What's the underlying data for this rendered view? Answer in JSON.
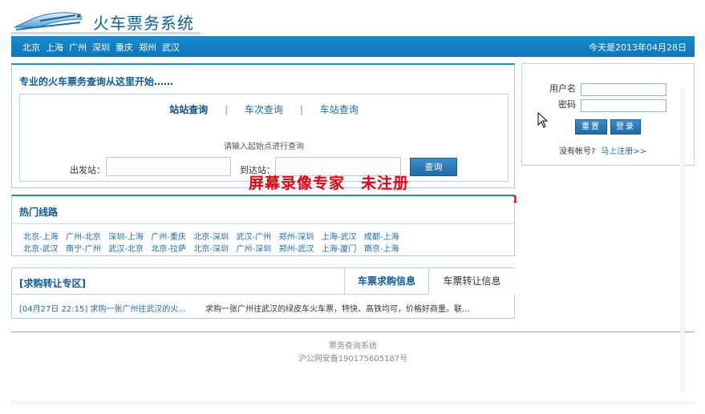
{
  "header": {
    "site_title": "火车票务系统"
  },
  "nav": {
    "cities": [
      "北京",
      "上海",
      "广州",
      "深圳",
      "重庆",
      "郑州",
      "武汉"
    ],
    "date": "今天是2013年04月28日"
  },
  "search": {
    "title": "专业的火车票务查询从这里开始……",
    "tabs": [
      "站站查询",
      "车次查询",
      "车站查询"
    ],
    "tab_sep": "|",
    "hint": "请输入起始点进行查询",
    "from_label": "出发站：",
    "to_label": "到达站：",
    "search_button": "查询"
  },
  "login": {
    "username_label": "用户名",
    "password_label": "密码",
    "reset_button": "重置",
    "login_button": "登录",
    "no_account": "没有帐号?",
    "register_link": "马上注册>>"
  },
  "watermark": "屏幕录像专家　未注册",
  "red_mark": "1",
  "routes": {
    "title": "热门线路",
    "items": [
      "北京-上海",
      "广州-北京",
      "深圳-上海",
      "广州-重庆",
      "北京-深圳",
      "武汉-广州",
      "郑州-深圳",
      "上海-武汉",
      "成都-上海",
      "北京-武汉",
      "南宁-广州",
      "武汉-北京",
      "北京-拉萨",
      "北京-深圳",
      "广州-深圳",
      "郑州-武汉",
      "上海-厦门",
      "南京-上海"
    ]
  },
  "transfer": {
    "title": "[求购转让专区]",
    "tab_buy": "车票求购信息",
    "tab_sell": "车票转让信息",
    "item_link": "[04月27日 22:15] 求购一张广州往武汉的火...",
    "item_desc": "求购一张广州往武汉的绿皮车火车票，特快、高铁均可，价格好商量。联..."
  },
  "footer": {
    "line1": "票务查询系统",
    "line2": "沪公网安备190175605187号"
  },
  "colors": {
    "nav_bg": "#1a8ccc",
    "title_blue": "#0d5a96",
    "link_blue": "#1b6aa8",
    "watermark_red": "#e60012"
  }
}
